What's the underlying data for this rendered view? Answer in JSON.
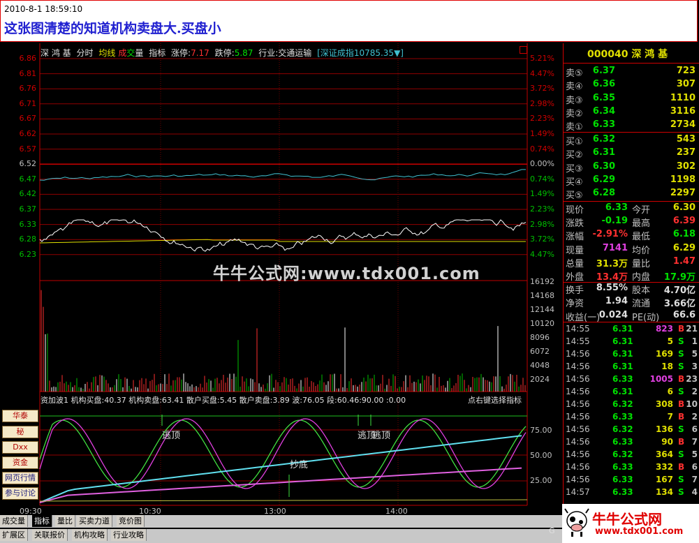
{
  "caption": {
    "date": "2010-8-1 18:59:10",
    "text": "这张图清楚的知道机构卖盘大.买盘小"
  },
  "chart": {
    "top_bar": {
      "stock": "深 鸿 基",
      "tab_fenshi": "分时",
      "tab_junxian": "均线",
      "tab_cheng": "成",
      "tab_jiao": "交",
      "tab_liang": "量",
      "tab_zhibiao": "指标",
      "limit_up_label": "涨停:",
      "limit_up": "7.17",
      "limit_down_label": "跌停:",
      "limit_down": "5.87",
      "industry_label": "行业:",
      "industry": "交通运输",
      "index_label": "[深证成指",
      "index_value": "10785.35▼]"
    },
    "price_labels": [
      "6.86",
      "6.81",
      "6.76",
      "6.71",
      "6.67",
      "6.62",
      "6.57",
      "6.52",
      "6.47",
      "6.42",
      "6.37",
      "6.33",
      "6.28",
      "6.23"
    ],
    "pct_labels": [
      "5.21%",
      "4.47%",
      "3.72%",
      "2.98%",
      "2.23%",
      "1.49%",
      "0.74%",
      "0.00%",
      "0.74%",
      "1.49%",
      "2.23%",
      "2.98%",
      "3.72%",
      "4.47%"
    ],
    "volume_labels": [
      "16192",
      "14168",
      "12144",
      "10120",
      "8096",
      "6072",
      "4048",
      "2024"
    ],
    "indicator_line": {
      "name": "资加波1",
      "inst_buy": "机构买盘:40.37",
      "inst_sell": "机构卖盘:63.41",
      "retail_buy": "散户买盘:5.45",
      "retail_sell": "散户卖盘:3.89",
      "wave": "波:76.05",
      "seg": "段:60.46",
      "n90": ":90.00",
      "n0": ":0.00",
      "hint": "点右键选择指标"
    },
    "indicator_axis": [
      "75.00",
      "50.00",
      "25.00"
    ],
    "annotations": {
      "escape_top_1": "逃顶",
      "escape_top_2": "逃顶",
      "escape_top_3": "逃顶",
      "bottom": "抄底"
    },
    "time_labels": [
      "09:30",
      "10:30",
      "13:00",
      "14:00"
    ],
    "watermark": "牛牛公式网:www.tdx001.com",
    "side_buttons": [
      "华泰",
      "秘",
      "Dxx",
      "资金",
      "网页行情",
      "参与讨论"
    ]
  },
  "quote": {
    "code": "000040",
    "name": "深 鸿 基",
    "sell": [
      {
        "label": "卖⑤",
        "price": "6.37",
        "vol": "723"
      },
      {
        "label": "卖④",
        "price": "6.36",
        "vol": "307"
      },
      {
        "label": "卖③",
        "price": "6.35",
        "vol": "1110"
      },
      {
        "label": "卖②",
        "price": "6.34",
        "vol": "3116"
      },
      {
        "label": "卖①",
        "price": "6.33",
        "vol": "2734"
      }
    ],
    "buy": [
      {
        "label": "买①",
        "price": "6.32",
        "vol": "543"
      },
      {
        "label": "买②",
        "price": "6.31",
        "vol": "237"
      },
      {
        "label": "买③",
        "price": "6.30",
        "vol": "302"
      },
      {
        "label": "买④",
        "price": "6.29",
        "vol": "1198"
      },
      {
        "label": "买⑤",
        "price": "6.28",
        "vol": "2297"
      }
    ],
    "stats": [
      {
        "l1": "现价",
        "v1": "6.33",
        "l2": "今开",
        "v2": "6.30"
      },
      {
        "l1": "涨跌",
        "v1": "-0.19",
        "l2": "最高",
        "v2": "6.39"
      },
      {
        "l1": "涨幅",
        "v1": "-2.91%",
        "l2": "最低",
        "v2": "6.18"
      },
      {
        "l1": "现量",
        "v1": "7141",
        "l2": "均价",
        "v2": "6.29"
      },
      {
        "l1": "总量",
        "v1": "31.3万",
        "l2": "量比",
        "v2": "1.47"
      },
      {
        "l1": "外盘",
        "v1": "13.4万",
        "l2": "内盘",
        "v2": "17.9万"
      },
      {
        "l1": "换手",
        "v1": "8.55%",
        "l2": "股本",
        "v2": "4.70亿"
      },
      {
        "l1": "净资",
        "v1": "1.94",
        "l2": "流通",
        "v2": "3.66亿"
      },
      {
        "l1": "收益(一)",
        "v1": "0.024",
        "l2": "PE(动)",
        "v2": "66.6"
      }
    ],
    "ticks": [
      {
        "t": "14:55",
        "p": "6.31",
        "v": "823",
        "bs": "B",
        "n": "21"
      },
      {
        "t": "14:55",
        "p": "6.31",
        "v": "5",
        "bs": "S",
        "n": "1"
      },
      {
        "t": "14:56",
        "p": "6.31",
        "v": "169",
        "bs": "S",
        "n": "5"
      },
      {
        "t": "14:56",
        "p": "6.31",
        "v": "18",
        "bs": "S",
        "n": "3"
      },
      {
        "t": "14:56",
        "p": "6.33",
        "v": "1005",
        "bs": "B",
        "n": "23"
      },
      {
        "t": "14:56",
        "p": "6.31",
        "v": "6",
        "bs": "S",
        "n": "2"
      },
      {
        "t": "14:56",
        "p": "6.32",
        "v": "308",
        "bs": "B",
        "n": "10"
      },
      {
        "t": "14:56",
        "p": "6.33",
        "v": "7",
        "bs": "B",
        "n": "2"
      },
      {
        "t": "14:56",
        "p": "6.32",
        "v": "136",
        "bs": "S",
        "n": "6"
      },
      {
        "t": "14:56",
        "p": "6.33",
        "v": "90",
        "bs": "B",
        "n": "7"
      },
      {
        "t": "14:56",
        "p": "6.32",
        "v": "364",
        "bs": "S",
        "n": "5"
      },
      {
        "t": "14:56",
        "p": "6.33",
        "v": "332",
        "bs": "B",
        "n": "6"
      },
      {
        "t": "14:56",
        "p": "6.33",
        "v": "167",
        "bs": "S",
        "n": "7"
      },
      {
        "t": "14:57",
        "p": "6.33",
        "v": "134",
        "bs": "S",
        "n": "4"
      }
    ]
  },
  "bottom_tabs": {
    "row1": [
      "成交量",
      "指标",
      "量比",
      "买卖力道",
      "竞价图"
    ],
    "row2": [
      "扩展区",
      "关联报价",
      "机构攻略",
      "行业攻略"
    ]
  },
  "logo": {
    "title": "牛牛公式网",
    "url": "www.tdx001.com",
    "ge": "G"
  },
  "colors": {
    "grid": "#c00000",
    "price_line": "#ffffff",
    "avg_line": "#e0e000",
    "index_line": "#40c0d0",
    "up": "#ff3030",
    "down": "#00e000"
  }
}
